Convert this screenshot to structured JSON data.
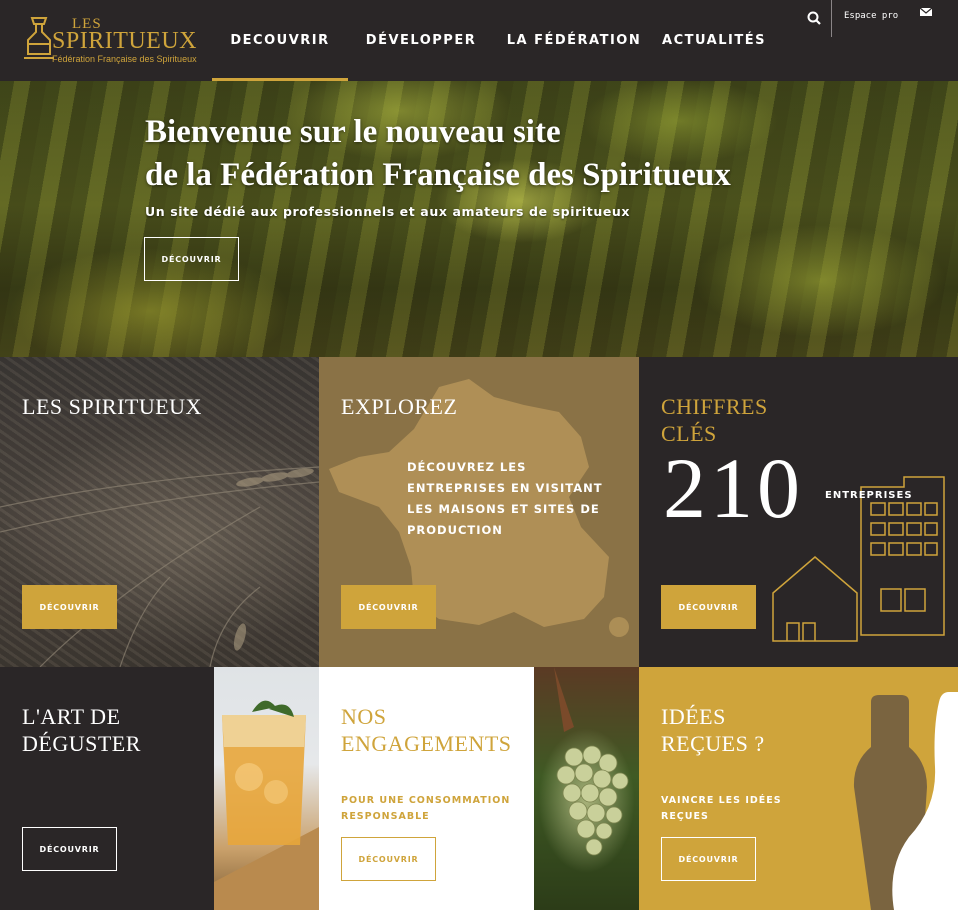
{
  "header": {
    "logo": {
      "les": "LES",
      "name": "SPIRITUEUX",
      "tagline": "Fédération Française des Spiritueux"
    },
    "nav": [
      {
        "label": "DECOUVRIR",
        "active": true
      },
      {
        "label": "DÉVELOPPER",
        "active": false
      },
      {
        "label": "LA FÉDÉRATION",
        "active": false
      },
      {
        "label": "ACTUALITÉS",
        "active": false
      }
    ],
    "search_icon": "search-icon",
    "espace_pro": "Espace pro",
    "mail_icon": "envelope-icon"
  },
  "hero": {
    "title_line1": "Bienvenue sur le nouveau site",
    "title_line2": "de la Fédération Française des Spiritueux",
    "subtitle": "Un site dédié aux professionnels et aux amateurs de spiritueux",
    "button": "DÉCOUVRIR"
  },
  "tiles": {
    "spiritueux": {
      "title": "LES SPIRITUEUX",
      "button": "DÉCOUVRIR"
    },
    "explorez": {
      "title": "EXPLOREZ",
      "text": "DÉCOUVREZ LES ENTREPRISES EN VISITANT LES MAISONS ET SITES DE PRODUCTION",
      "button": "DÉCOUVRIR"
    },
    "chiffres": {
      "title_line1": "CHIFFRES",
      "title_line2": "CLÉS",
      "number": "210",
      "unit": "ENTREPRISES",
      "button": "DÉCOUVRIR"
    },
    "art": {
      "title_line1": "L'ART DE",
      "title_line2": "DÉGUSTER",
      "button": "DÉCOUVRIR"
    },
    "engagements": {
      "title_line1": "NOS",
      "title_line2": "ENGAGEMENTS",
      "text": "POUR UNE CONSOMMATION RESPONSABLE",
      "button": "DÉCOUVRIR"
    },
    "idees": {
      "title_line1": "IDÉES",
      "title_line2": "REÇUES ?",
      "text": "VAINCRE LES IDÉES REÇUES",
      "button": "DÉCOUVRIR"
    }
  },
  "colors": {
    "gold": "#cfa43b",
    "dark": "#2a2627",
    "tan": "#8a7246"
  }
}
